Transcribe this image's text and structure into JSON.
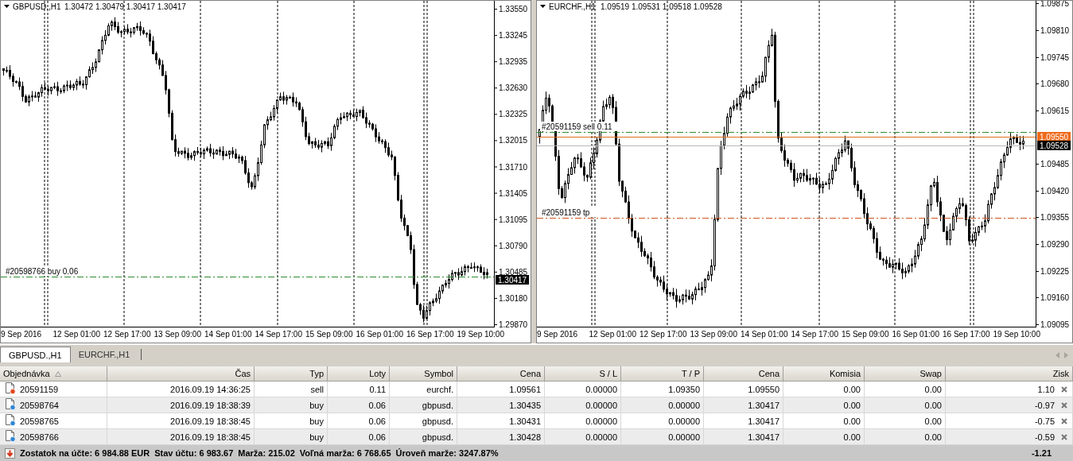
{
  "charts": [
    {
      "symbol": "GBPUSD.,H1",
      "ohlc": "1.30472 1.30479 1.30417 1.30417",
      "price_labels": [
        "1.33550",
        "1.33245",
        "1.32935",
        "1.32630",
        "1.32325",
        "1.32015",
        "1.31710",
        "1.31405",
        "1.31095",
        "1.30790",
        "1.30485",
        "1.30180",
        "1.29870"
      ],
      "time_labels": [
        "9 Sep 2016",
        "12 Sep 01:00",
        "12 Sep 17:00",
        "13 Sep 09:00",
        "14 Sep 01:00",
        "14 Sep 17:00",
        "15 Sep 09:00",
        "16 Sep 01:00",
        "16 Sep 17:00",
        "19 Sep 10:00"
      ],
      "lines": [
        {
          "kind": "open",
          "label": "#20598766 buy 0.06"
        }
      ],
      "tags": [
        {
          "kind": "bid",
          "text": "1.30417"
        }
      ]
    },
    {
      "symbol": "EURCHF.,H1",
      "ohlc": "1.09519 1.09531 1.09518 1.09528",
      "price_labels": [
        "1.09875",
        "1.09810",
        "1.09745",
        "1.09680",
        "1.09615",
        "1.09485",
        "1.09420",
        "1.09355",
        "1.09290",
        "1.09225",
        "1.09160",
        "1.09095"
      ],
      "time_labels": [
        "9 Sep 2016",
        "12 Sep 01:00",
        "12 Sep 17:00",
        "13 Sep 09:00",
        "14 Sep 01:00",
        "14 Sep 17:00",
        "15 Sep 09:00",
        "16 Sep 01:00",
        "16 Sep 17:00",
        "19 Sep 10:00"
      ],
      "lines": [
        {
          "kind": "open",
          "label": "#20591159 sell 0.11"
        },
        {
          "kind": "ask"
        },
        {
          "kind": "bid"
        },
        {
          "kind": "tp",
          "label": "#20591159 tp"
        }
      ],
      "tags": [
        {
          "kind": "ask",
          "text": "1.09550"
        },
        {
          "kind": "bid",
          "text": "1.09528"
        }
      ]
    }
  ],
  "tabs": [
    {
      "label": "GBPUSD.,H1",
      "selected": true
    },
    {
      "label": "EURCHF.,H1",
      "selected": false
    }
  ],
  "table": {
    "columns": [
      {
        "label": "Objednávka",
        "sorted": true
      },
      {
        "label": "Čas",
        "sorted": false
      },
      {
        "label": "Typ",
        "sorted": false
      },
      {
        "label": "Loty",
        "sorted": false
      },
      {
        "label": "Symbol",
        "sorted": false
      },
      {
        "label": "Cena",
        "sorted": false
      },
      {
        "label": "S / L",
        "sorted": false
      },
      {
        "label": "T / P",
        "sorted": false
      },
      {
        "label": "Cena",
        "sorted": false
      },
      {
        "label": "Komisia",
        "sorted": false
      },
      {
        "label": "Swap",
        "sorted": false
      },
      {
        "label": "Zisk",
        "sorted": false
      }
    ],
    "rows": [
      {
        "kind": "sell",
        "cells": [
          "20591159",
          "2016.09.19 14:36:25",
          "sell",
          "0.11",
          "eurchf.",
          "1.09561",
          "0.00000",
          "1.09350",
          "1.09550",
          "0.00",
          "0.00",
          "1.10"
        ]
      },
      {
        "kind": "buy",
        "cells": [
          "20598764",
          "2016.09.19 18:38:39",
          "buy",
          "0.06",
          "gbpusd.",
          "1.30435",
          "0.00000",
          "0.00000",
          "1.30417",
          "0.00",
          "0.00",
          "-0.97"
        ]
      },
      {
        "kind": "buy",
        "cells": [
          "20598765",
          "2016.09.19 18:38:45",
          "buy",
          "0.06",
          "gbpusd.",
          "1.30431",
          "0.00000",
          "0.00000",
          "1.30417",
          "0.00",
          "0.00",
          "-0.75"
        ]
      },
      {
        "kind": "buy",
        "cells": [
          "20598766",
          "2016.09.19 18:38:45",
          "buy",
          "0.06",
          "gbpusd.",
          "1.30428",
          "0.00000",
          "0.00000",
          "1.30417",
          "0.00",
          "0.00",
          "-0.59"
        ]
      }
    ],
    "summary": [
      "Zostatok na účte: 6 984.88 EUR",
      "Stav účtu: 6 983.67",
      "Marža: 215.02",
      "Voľná marža: 6 768.65",
      "Úroveň marže: 3247.87%"
    ],
    "total_profit": "-1.21"
  }
}
